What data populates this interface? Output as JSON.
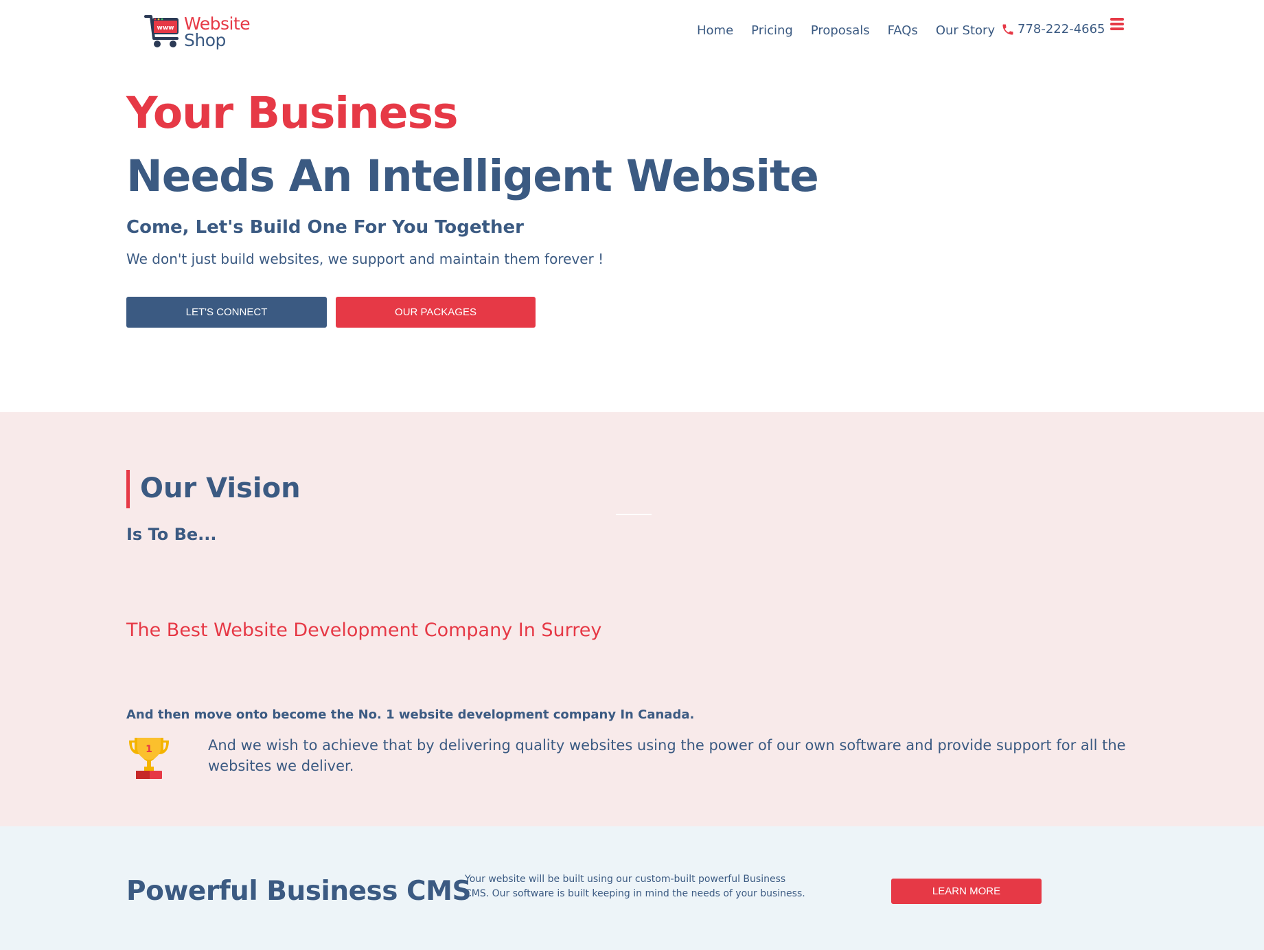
{
  "header": {
    "logo": {
      "line1": "Website",
      "line2": "Shop",
      "badge": "www"
    },
    "nav": [
      "Home",
      "Pricing",
      "Proposals",
      "FAQs",
      "Our Story"
    ],
    "phone": "778-222-4665"
  },
  "hero": {
    "title_line1": "Your Business",
    "title_line2": "Needs An Intelligent Website",
    "subtitle": "Come, Let's Build One For You Together",
    "description": "We don't just build websites, we support and maintain them forever !",
    "connect_label": "LET'S CONNECT",
    "packages_label": "OUR PACKAGES"
  },
  "vision": {
    "title": "Our Vision",
    "subtitle": "Is To Be...",
    "best": "The Best Website Development Company In Surrey",
    "then": "And then move onto become the No. 1 website development company In Canada.",
    "achieve": "And we wish to achieve that by delivering quality websites using the power of our own software and provide support for all the websites we deliver.",
    "trophy_number": "1"
  },
  "cms": {
    "title": "Powerful Business CMS",
    "description": "Your website will be built using our custom-built powerful Business CMS. Our software is built keeping in mind the needs of your business.",
    "learn_label": "LEARN MORE"
  },
  "colors": {
    "primary": "#3b5a82",
    "accent": "#e63946",
    "vision_bg": "#f8eaea",
    "cms_bg": "#edf4f8"
  },
  "icons": {
    "phone": "phone-icon",
    "menu": "hamburger-menu-icon",
    "cart": "cart-icon",
    "trophy": "trophy-icon"
  }
}
